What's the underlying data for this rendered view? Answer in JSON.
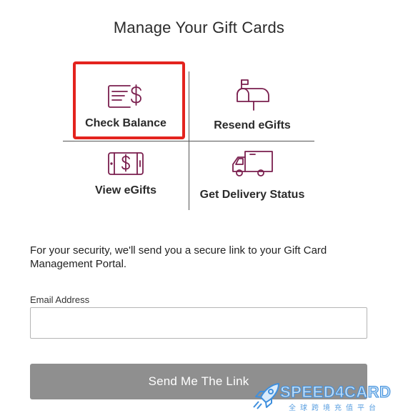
{
  "page": {
    "title": "Manage Your Gift Cards"
  },
  "options": [
    {
      "label": "Check Balance",
      "icon": "gift-card-dollar-icon"
    },
    {
      "label": "Resend eGifts",
      "icon": "mailbox-icon"
    },
    {
      "label": "View eGifts",
      "icon": "phone-dollar-icon"
    },
    {
      "label": "Get Delivery Status",
      "icon": "delivery-truck-icon"
    }
  ],
  "security": {
    "text": "For your security, we'll send you a secure link to your Gift Card Management Portal."
  },
  "email": {
    "label": "Email Address",
    "value": "",
    "placeholder": ""
  },
  "submit": {
    "label": "Send Me The Link"
  },
  "watermark": {
    "brand": "SPEED4CARD",
    "subtitle": "全球跨境充值平台"
  },
  "colors": {
    "icon": "#7a1f4e",
    "highlight": "#e3231e",
    "button": "#8f8f8f",
    "watermark": "#3f8fdd"
  }
}
